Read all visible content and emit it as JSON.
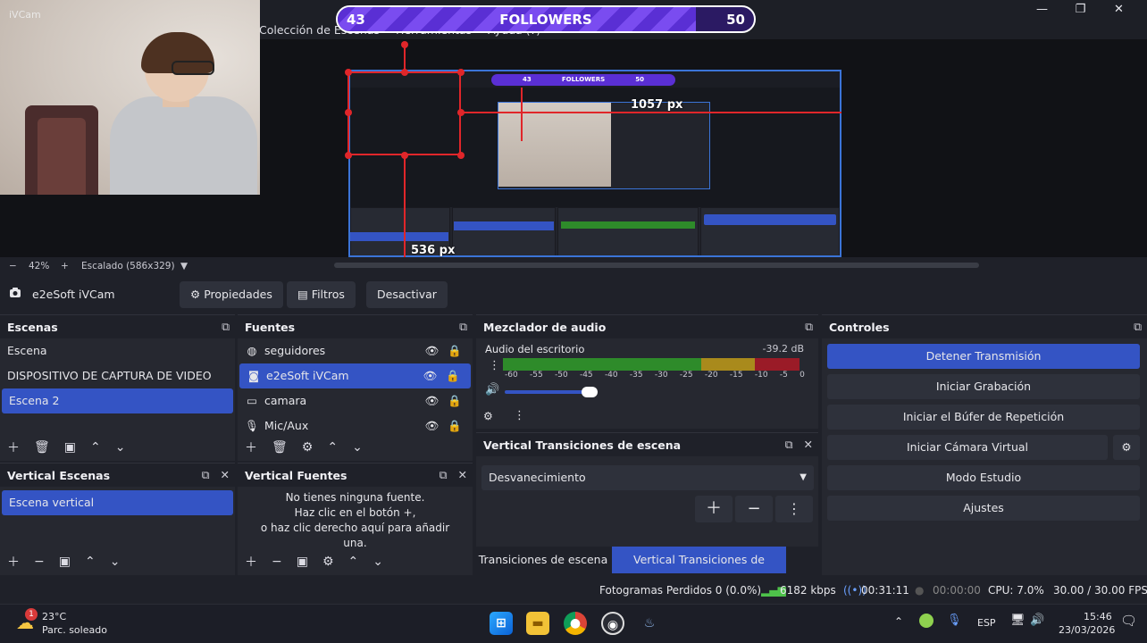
{
  "window": {
    "menu": [
      "Colección de Escenas",
      "Herramientas",
      "Ayuda (?)"
    ],
    "controls": [
      "—",
      "❐",
      "✕"
    ]
  },
  "webcam": {
    "label": "iVCam"
  },
  "followers_widget": {
    "left_value": "43",
    "title": "FOLLOWERS",
    "right_value": "50",
    "progress_fraction": 0.86
  },
  "preview": {
    "nested_followers_left": "43",
    "nested_followers_title": "FOLLOWERS",
    "nested_followers_right": "50",
    "measure_horizontal": "1057 px",
    "measure_vertical": "536 px"
  },
  "zoombar": {
    "minus": "−",
    "zoom": "42%",
    "plus": "+",
    "scaling": "Escalado (586x329)",
    "menu_icon": "▼"
  },
  "source_toolbar": {
    "source_name": "e2eSoft iVCam",
    "properties": "Propiedades",
    "filters": "Filtros",
    "deactivate": "Desactivar"
  },
  "scenes": {
    "title": "Escenas",
    "items": [
      "Escena",
      "DISPOSITIVO DE CAPTURA DE VIDEO",
      "Escena 2"
    ],
    "selected_index": 2
  },
  "sources": {
    "title": "Fuentes",
    "items": [
      {
        "icon": "globe-icon",
        "label": "seguidores"
      },
      {
        "icon": "camera-icon",
        "label": "e2eSoft iVCam"
      },
      {
        "icon": "monitor-icon",
        "label": "camara"
      },
      {
        "icon": "microphone-icon",
        "label": "Mic/Aux"
      }
    ],
    "selected_index": 1
  },
  "audio_mixer": {
    "title": "Mezclador de audio",
    "track_name": "Audio del escritorio",
    "level": "-39.2 dB",
    "ticks": [
      "-60",
      "-55",
      "-50",
      "-45",
      "-40",
      "-35",
      "-30",
      "-25",
      "-20",
      "-15",
      "-10",
      "-5",
      "0"
    ],
    "volume_fraction": 0.3
  },
  "vertical_transitions": {
    "title": "Vertical Transiciones de escena",
    "selected": "Desvanecimiento",
    "tabs": [
      "Transiciones de escena",
      "Vertical Transiciones de escena"
    ],
    "active_tab": 1
  },
  "controls": {
    "title": "Controles",
    "buttons": [
      "Detener Transmisión",
      "Iniciar Grabación",
      "Iniciar el Búfer de Repetición",
      "Iniciar Cámara Virtual",
      "Modo Estudio",
      "Ajustes"
    ]
  },
  "vertical_scenes": {
    "title": "Vertical Escenas",
    "items": [
      "Escena vertical"
    ]
  },
  "vertical_sources": {
    "title": "Vertical Fuentes",
    "empty_line1": "No tienes ninguna fuente.",
    "empty_line2": "Haz clic en el botón +,",
    "empty_line3": "o haz clic derecho aquí para añadir",
    "empty_line4": "una."
  },
  "status": {
    "dropped": "Fotogramas Perdidos 0 (0.0%)",
    "bitrate": "6182 kbps",
    "stream_time": "00:31:11",
    "rec_time": "00:00:00",
    "cpu": "CPU: 7.0%",
    "fps": "30.00 / 30.00 FPS"
  },
  "taskbar": {
    "weather_temp": "23°C",
    "weather_desc": "Parc. soleado",
    "weather_badge": "1",
    "language": "ESP",
    "time": "15:46",
    "date": "23/03/2026"
  },
  "colors": {
    "accent": "#3454c4",
    "red_guides": "#e0262a",
    "followers_bar": "#5a2fd4"
  }
}
